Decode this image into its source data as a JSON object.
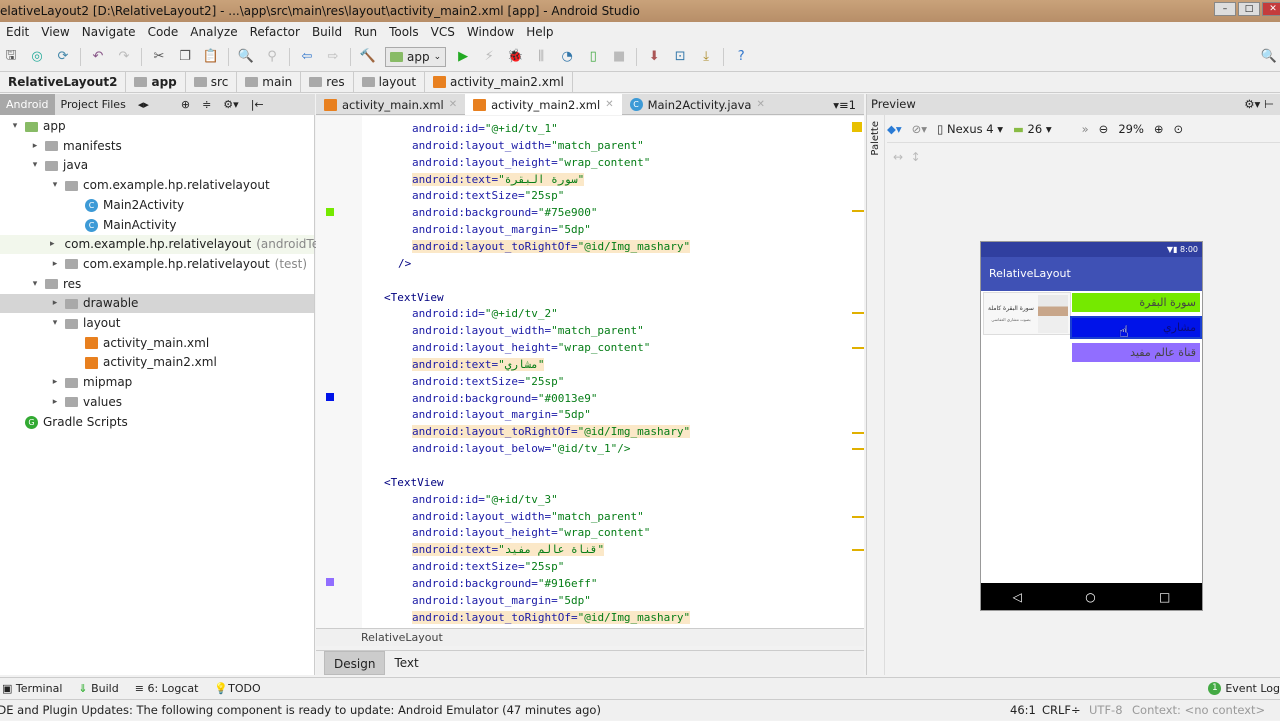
{
  "window": {
    "title": "elativeLayout2 [D:\\RelativeLayout2] - ...\\app\\src\\main\\res\\layout\\activity_main2.xml [app] - Android Studio"
  },
  "menu": [
    "Edit",
    "View",
    "Navigate",
    "Code",
    "Analyze",
    "Refactor",
    "Build",
    "Run",
    "Tools",
    "VCS",
    "Window",
    "Help"
  ],
  "toolbar": {
    "config": "app"
  },
  "breadcrumb": [
    "RelativeLayout2",
    "app",
    "src",
    "main",
    "res",
    "layout",
    "activity_main2.xml"
  ],
  "project_tabs": [
    "Android",
    "Project Files"
  ],
  "tree": [
    {
      "label": "app",
      "indent": 0,
      "arrow": "▾",
      "icon": "folder"
    },
    {
      "label": "manifests",
      "indent": 1,
      "arrow": "▸",
      "icon": "folder"
    },
    {
      "label": "java",
      "indent": 1,
      "arrow": "▾",
      "icon": "folder"
    },
    {
      "label": "com.example.hp.relativelayout",
      "indent": 2,
      "arrow": "▾",
      "icon": "folder"
    },
    {
      "label": "Main2Activity",
      "indent": 3,
      "arrow": "",
      "icon": "class"
    },
    {
      "label": "MainActivity",
      "indent": 3,
      "arrow": "",
      "icon": "class"
    },
    {
      "label": "com.example.hp.relativelayout",
      "suffix": "(androidTest)",
      "indent": 2,
      "arrow": "▸",
      "icon": "folder",
      "hl": true
    },
    {
      "label": "com.example.hp.relativelayout",
      "suffix": "(test)",
      "indent": 2,
      "arrow": "▸",
      "icon": "folder"
    },
    {
      "label": "res",
      "indent": 1,
      "arrow": "▾",
      "icon": "folder"
    },
    {
      "label": "drawable",
      "indent": 2,
      "arrow": "▸",
      "icon": "folder",
      "sel": true
    },
    {
      "label": "layout",
      "indent": 2,
      "arrow": "▾",
      "icon": "folder"
    },
    {
      "label": "activity_main.xml",
      "indent": 3,
      "arrow": "",
      "icon": "xml"
    },
    {
      "label": "activity_main2.xml",
      "indent": 3,
      "arrow": "",
      "icon": "xml"
    },
    {
      "label": "mipmap",
      "indent": 2,
      "arrow": "▸",
      "icon": "folder"
    },
    {
      "label": "values",
      "indent": 2,
      "arrow": "▸",
      "icon": "folder"
    },
    {
      "label": "Gradle Scripts",
      "indent": 0,
      "arrow": "",
      "icon": "gradle"
    }
  ],
  "editor_tabs": [
    "activity_main.xml",
    "activity_main2.xml",
    "Main2Activity.java"
  ],
  "code": [
    {
      "a": "android:id=",
      "v": "\"@+id/tv_1\"",
      "i": 1
    },
    {
      "a": "android:layout_width=",
      "v": "\"match_parent\"",
      "i": 1
    },
    {
      "a": "android:layout_height=",
      "v": "\"wrap_content\"",
      "i": 1
    },
    {
      "a": "android:text=",
      "v": "\"سورة البقرة\"",
      "i": 1,
      "hl": true
    },
    {
      "a": "android:textSize=",
      "v": "\"25sp\"",
      "i": 1
    },
    {
      "a": "android:background=",
      "v": "\"#75e900\"",
      "i": 1
    },
    {
      "a": "android:layout_margin=",
      "v": "\"5dp\"",
      "i": 1
    },
    {
      "a": "android:layout_toRightOf=",
      "v": "\"@id/Img_mashary\"",
      "i": 1,
      "hl": true
    },
    {
      "t": "/>",
      "i": 0.5
    },
    {
      "t": "",
      "i": 0
    },
    {
      "t": "<TextView",
      "i": 0
    },
    {
      "a": "android:id=",
      "v": "\"@+id/tv_2\"",
      "i": 1
    },
    {
      "a": "android:layout_width=",
      "v": "\"match_parent\"",
      "i": 1
    },
    {
      "a": "android:layout_height=",
      "v": "\"wrap_content\"",
      "i": 1
    },
    {
      "a": "android:text=",
      "v": "\"مشاري\"",
      "i": 1,
      "hl": true
    },
    {
      "a": "android:textSize=",
      "v": "\"25sp\"",
      "i": 1
    },
    {
      "a": "android:background=",
      "v": "\"#0013e9\"",
      "i": 1
    },
    {
      "a": "android:layout_margin=",
      "v": "\"5dp\"",
      "i": 1
    },
    {
      "a": "android:layout_toRightOf=",
      "v": "\"@id/Img_mashary\"",
      "i": 1,
      "hl": true
    },
    {
      "a": "android:layout_below=",
      "v": "\"@id/tv_1\"/>",
      "i": 1
    },
    {
      "t": "",
      "i": 0
    },
    {
      "t": "<TextView",
      "i": 0
    },
    {
      "a": "android:id=",
      "v": "\"@+id/tv_3\"",
      "i": 1
    },
    {
      "a": "android:layout_width=",
      "v": "\"match_parent\"",
      "i": 1
    },
    {
      "a": "android:layout_height=",
      "v": "\"wrap_content\"",
      "i": 1
    },
    {
      "a": "android:text=",
      "v": "\"قناة عالم مفيد\"",
      "i": 1,
      "hl": true
    },
    {
      "a": "android:textSize=",
      "v": "\"25sp\"",
      "i": 1
    },
    {
      "a": "android:background=",
      "v": "\"#916eff\"",
      "i": 1
    },
    {
      "a": "android:layout_margin=",
      "v": "\"5dp\"",
      "i": 1
    },
    {
      "a": "android:layout_toRightOf=",
      "v": "\"@id/Img_mashary\"",
      "i": 1,
      "hl": true
    }
  ],
  "gutter_colors": {
    "tv_1": "#75e900",
    "tv_2": "#0013e9",
    "tv_3": "#916eff"
  },
  "editor_footer": "RelativeLayout",
  "design_tabs": [
    "Design",
    "Text"
  ],
  "preview": {
    "title": "Preview",
    "palette": "Palette",
    "device": "Nexus 4",
    "api": "26",
    "zoom": "29%",
    "status_time": "8:00",
    "app_title": "RelativeLayout",
    "image_caption": "سورة البقرة كاملة",
    "image_sub": "بصوت مشاري العفاسي",
    "texts": [
      "سورة البقرة",
      "مشاري",
      "قناة عالم مفيد"
    ]
  },
  "bottom_tools": [
    "Terminal",
    "Build",
    "6: Logcat",
    "TODO"
  ],
  "event_log": "Event Log",
  "event_count": "1",
  "status": {
    "message": "IDE and Plugin Updates: The following component is ready to update: Android Emulator (47 minutes ago)",
    "position": "46:1",
    "line_sep": "CRLF÷",
    "encoding": "UTF-8",
    "context": "Context: <no context>"
  }
}
